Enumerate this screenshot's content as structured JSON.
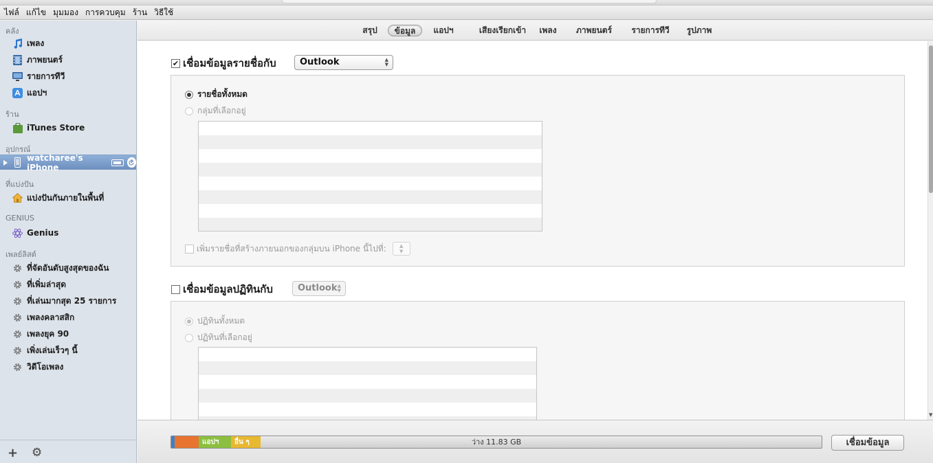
{
  "menu": [
    "ไฟล์",
    "แก้ไข",
    "มุมมอง",
    "การควบคุม",
    "ร้าน",
    "วิธีใช้"
  ],
  "sidebar": {
    "library_header": "คลัง",
    "library": [
      {
        "label": "เพลง",
        "icon": "music-note-icon"
      },
      {
        "label": "ภาพยนตร์",
        "icon": "film-icon"
      },
      {
        "label": "รายการทีวี",
        "icon": "tv-icon"
      },
      {
        "label": "แอปฯ",
        "icon": "app-store-icon"
      }
    ],
    "store_header": "ร้าน",
    "store": [
      {
        "label": "iTunes Store",
        "icon": "shopping-bag-icon"
      }
    ],
    "devices_header": "อุปกรณ์",
    "devices": [
      {
        "label": "watcharee's iPhone",
        "icon": "iphone-icon"
      }
    ],
    "shared_header": "ที่แบ่งปัน",
    "shared": [
      {
        "label": "แบ่งปันกันภายในพื้นที่",
        "icon": "home-share-icon"
      }
    ],
    "genius_header": "GENIUS",
    "genius": [
      {
        "label": "Genius",
        "icon": "genius-atom-icon"
      }
    ],
    "playlists_header": "เพลย์ลิสต์",
    "playlists": [
      {
        "label": "ที่จัดอันดับสูงสุดของฉัน",
        "icon": "smart-playlist-gear-icon"
      },
      {
        "label": "ที่เพิ่มล่าสุด",
        "icon": "smart-playlist-gear-icon"
      },
      {
        "label": "ที่เล่นมากสุด 25 รายการ",
        "icon": "smart-playlist-gear-icon"
      },
      {
        "label": "เพลงคลาสสิก",
        "icon": "smart-playlist-gear-icon"
      },
      {
        "label": "เพลงยุค 90",
        "icon": "smart-playlist-gear-icon"
      },
      {
        "label": "เพิ่งเล่นเร็วๆ นี้",
        "icon": "smart-playlist-gear-icon"
      },
      {
        "label": "วิดีโอเพลง",
        "icon": "smart-playlist-gear-icon"
      }
    ],
    "add_label": "+",
    "settings_label": "⚙"
  },
  "tabs": [
    {
      "label": "สรุป",
      "active": false
    },
    {
      "label": "ข้อมูล",
      "active": true
    },
    {
      "label": "แอปฯ",
      "active": false
    },
    {
      "label": "เสียงเรียกเข้า",
      "active": false
    },
    {
      "label": "เพลง",
      "active": false
    },
    {
      "label": "ภาพยนตร์",
      "active": false
    },
    {
      "label": "รายการทีวี",
      "active": false
    },
    {
      "label": "รูปภาพ",
      "active": false
    }
  ],
  "contacts": {
    "checked": true,
    "title": "เชื่อมข้อมูลรายชื่อกับ",
    "source": "Outlook",
    "option_all": "รายชื่อทั้งหมด",
    "option_selected": "กลุ่มที่เลือกอยู่",
    "add_new_label": "เพิ่มรายชื่อที่สร้างภายนอกของกลุ่มบน iPhone นี้ไปที่:"
  },
  "calendars": {
    "checked": false,
    "title": "เชื่อมข้อมูลปฏิทินกับ",
    "source": "Outlook",
    "option_all": "ปฏิทินทั้งหมด",
    "option_selected": "ปฏิทินที่เลือกอยู่"
  },
  "capacity": {
    "segments": [
      {
        "label": "",
        "color": "#3f80c8",
        "fraction": 0.002
      },
      {
        "label": "",
        "color": "#e8742f",
        "fraction": 0.037
      },
      {
        "label": "แอปฯ",
        "color": "#8cbf3f",
        "fraction": 0.05
      },
      {
        "label": "อื่น ๆ",
        "color": "#e8b830",
        "fraction": 0.045
      }
    ],
    "free_label": "ว่าง 11.83 GB"
  },
  "sync_button": "เชื่อมข้อมูล"
}
